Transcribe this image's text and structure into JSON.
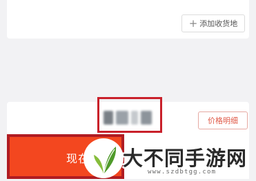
{
  "address_card": {
    "add_button_icon": "plus-icon",
    "add_button_label": "添加收货地"
  },
  "price_bar": {
    "price_detail_label": "价格明细",
    "pay_button_label": "现在"
  },
  "watermark": {
    "title": "大不同手游网",
    "url": "www.szdbtgg.com",
    "logo_icon": "leaf-logo-icon"
  },
  "colors": {
    "accent_red": "#c9202a",
    "pay_orange": "#f3471f",
    "logo_green": "#6aa52a"
  }
}
